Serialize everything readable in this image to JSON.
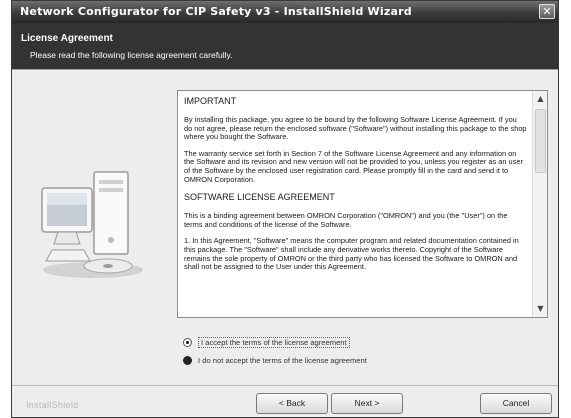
{
  "window": {
    "title": "Network Configurator for CIP Safety v3 - InstallShield Wizard",
    "close_glyph": "✕"
  },
  "header": {
    "title": "License Agreement",
    "subtitle": "Please read the following license agreement carefully."
  },
  "license": {
    "heading1": "IMPORTANT",
    "para1": "By installing this package, you agree to be bound by the following Software License Agreement. If you do not agree, please return the enclosed software (\"Software\") without installing this package to the shop where you bought the Software.",
    "para2": "The warranty service set forth in Section 7 of the Software License Agreement and any information on the Software and its revision and new version will not be provided to you, unless you register as an user of the Software by the enclosed user registration card. Please promptly fill in the card and send it to OMRON Corporation.",
    "heading2": "SOFTWARE LICENSE AGREEMENT",
    "para3": "This is a binding agreement between OMRON Corporation (\"OMRON\") and you (the \"User\") on the terms and conditions of the license of the Software.",
    "para4": "1. In this Agreement, \"Software\" means the computer program and related documentation contained in this package. The \"Software\" shall include any derivative works thereto. Copyright of the Software remains the sole property of OMRON or the third party who has licensed the Software to OMRON and shall not be assigned to the User under this Agreement."
  },
  "options": {
    "accept_label": "I accept the terms of the license agreement",
    "decline_label": "I do not accept the terms of the license agreement",
    "selected": "accept"
  },
  "footer": {
    "brand": "InstallShield",
    "back_label": "< Back",
    "next_label": "Next >",
    "cancel_label": "Cancel"
  }
}
